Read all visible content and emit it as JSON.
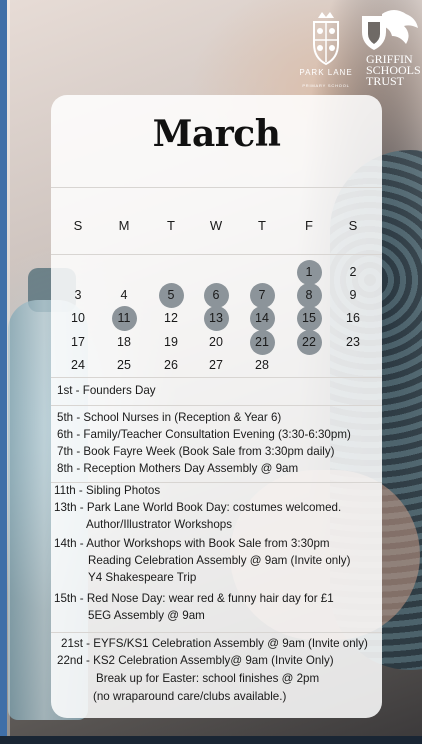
{
  "logos": {
    "park_lane": {
      "name": "PARK LANE",
      "subtitle": "PRIMARY SCHOOL"
    },
    "griffin": {
      "lines": [
        "GRIFFIN",
        "SCHOOLS",
        "TRUST"
      ]
    }
  },
  "calendar": {
    "month": "March",
    "weekdays": [
      "S",
      "M",
      "T",
      "W",
      "T",
      "F",
      "S"
    ],
    "weeks": [
      [
        "",
        "",
        "",
        "",
        "",
        "1",
        "2"
      ],
      [
        "3",
        "4",
        "5",
        "6",
        "7",
        "8",
        "9"
      ],
      [
        "10",
        "11",
        "12",
        "13",
        "14",
        "15",
        "16"
      ],
      [
        "17",
        "18",
        "19",
        "20",
        "21",
        "22",
        "23"
      ],
      [
        "24",
        "25",
        "26",
        "27",
        "28",
        "",
        ""
      ]
    ],
    "highlighted_days": [
      "1",
      "5",
      "6",
      "7",
      "8",
      "11",
      "13",
      "14",
      "15",
      "21",
      "22"
    ],
    "highlight_color": "#8c949a"
  },
  "events": [
    "1st - Founders Day",
    "5th - School Nurses in (Reception & Year 6)",
    "6th - Family/Teacher Consultation Evening (3:30-6:30pm)",
    "7th - Book Fayre Week (Book Sale from 3:30pm daily)",
    "8th - Reception Mothers Day Assembly @ 9am",
    "11th - Sibling Photos",
    "13th - Park Lane World Book Day: costumes welcomed.",
    "Author/Illustrator Workshops",
    "14th - Author Workshops with Book Sale from 3:30pm",
    "Reading Celebration Assembly @ 9am (Invite only)",
    "Y4 Shakespeare Trip",
    "15th - Red Nose Day: wear red & funny hair day for £1",
    "5EG Assembly @ 9am",
    "21st - EYFS/KS1 Celebration Assembly @ 9am  (Invite only)",
    "22nd - KS2 Celebration Assembly@ 9am (Invite Only)",
    "Break up for Easter: school finishes @ 2pm",
    "(no wraparound care/clubs available.)"
  ]
}
